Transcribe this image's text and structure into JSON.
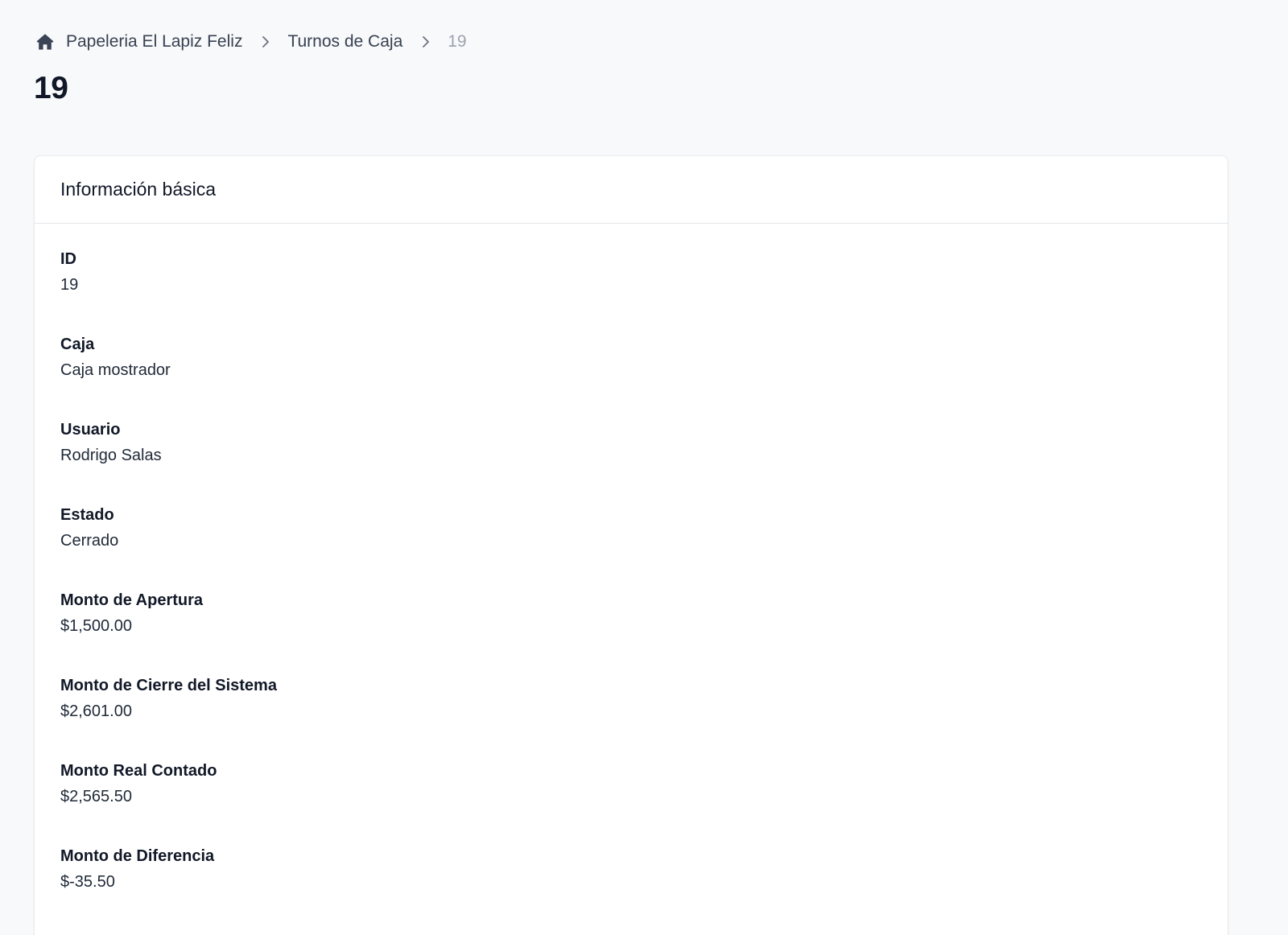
{
  "breadcrumb": {
    "home_icon": "home-icon",
    "items": [
      {
        "label": "Papeleria El Lapiz Feliz"
      },
      {
        "label": "Turnos de Caja"
      },
      {
        "label": "19"
      }
    ]
  },
  "page": {
    "title": "19"
  },
  "card": {
    "title": "Información básica",
    "fields": [
      {
        "label": "ID",
        "value": "19"
      },
      {
        "label": "Caja",
        "value": "Caja mostrador"
      },
      {
        "label": "Usuario",
        "value": "Rodrigo Salas"
      },
      {
        "label": "Estado",
        "value": "Cerrado"
      },
      {
        "label": "Monto de Apertura",
        "value": "$1,500.00"
      },
      {
        "label": "Monto de Cierre del Sistema",
        "value": "$2,601.00"
      },
      {
        "label": "Monto Real Contado",
        "value": "$2,565.50"
      },
      {
        "label": "Monto de Diferencia",
        "value": "$-35.50"
      }
    ]
  }
}
